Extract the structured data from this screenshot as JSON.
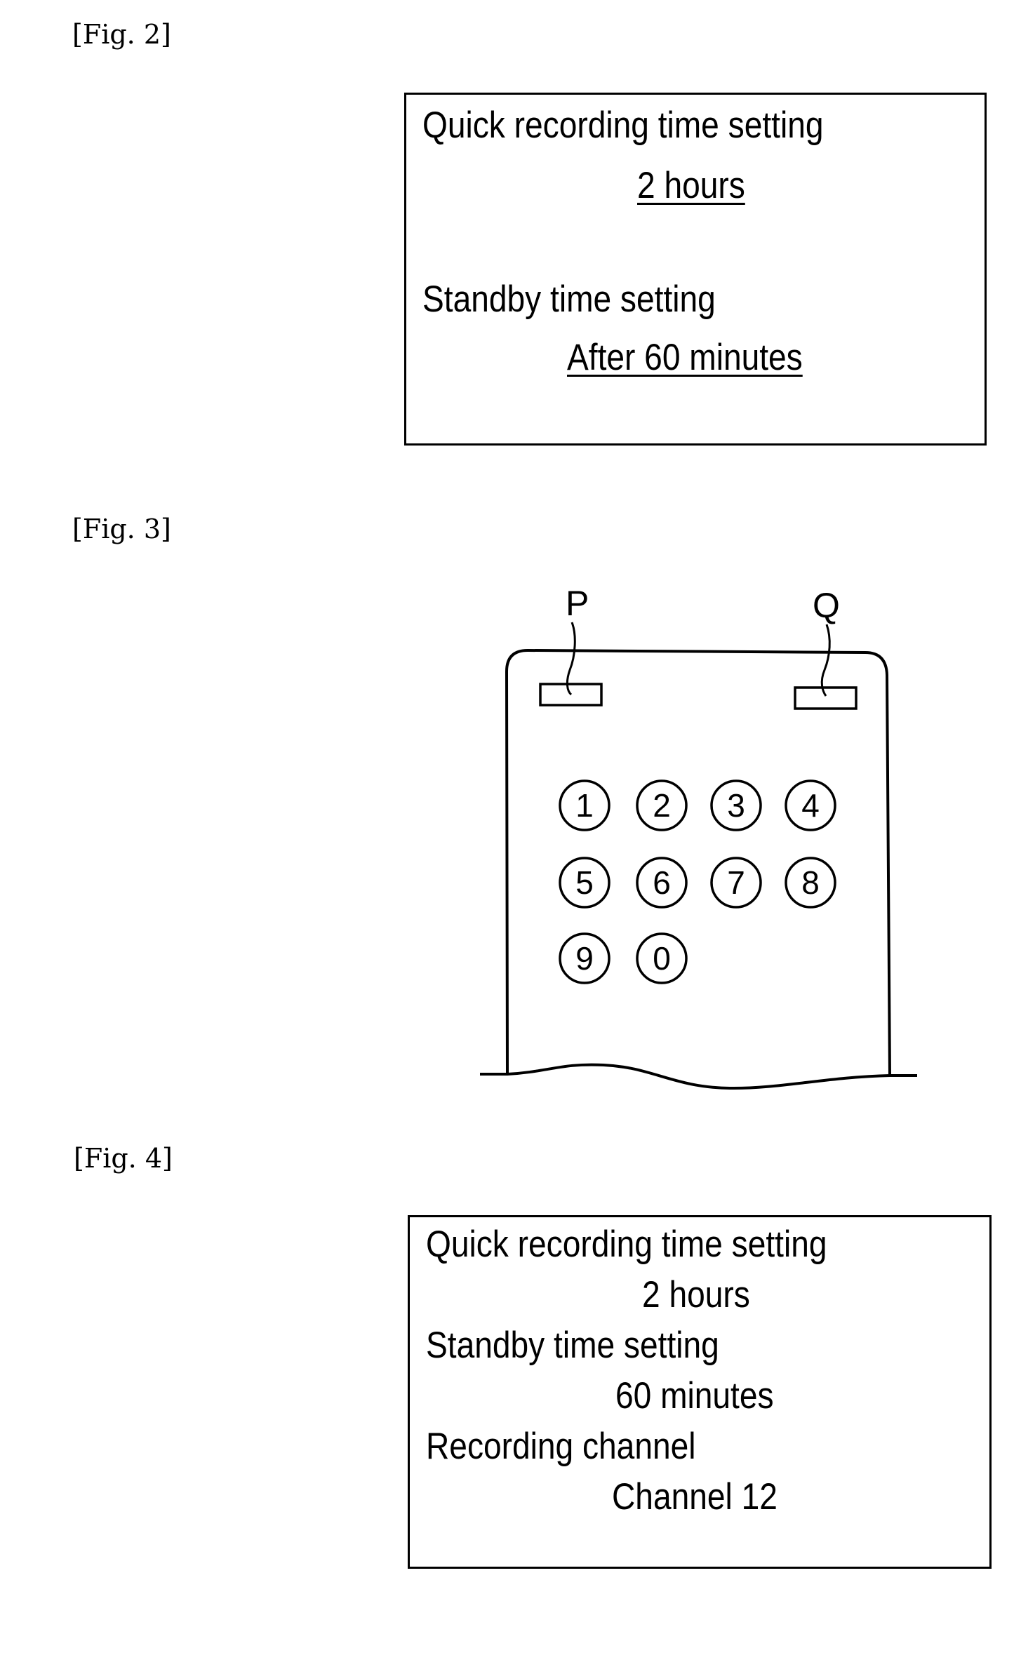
{
  "figures": {
    "fig2": {
      "label": "[Fig. 2]",
      "quick_recording_label": "Quick recording time setting",
      "quick_recording_value": "2 hours",
      "standby_label": "Standby time setting",
      "standby_value": "After 60 minutes"
    },
    "fig3": {
      "label": "[Fig. 3]",
      "callout_p": "P",
      "callout_q": "Q",
      "keys": [
        "1",
        "2",
        "3",
        "4",
        "5",
        "6",
        "7",
        "8",
        "9",
        "0"
      ]
    },
    "fig4": {
      "label": "[Fig. 4]",
      "quick_recording_label": "Quick recording time setting",
      "quick_recording_value": "2 hours",
      "standby_label": "Standby time setting",
      "standby_value": "60 minutes",
      "channel_label": "Recording channel",
      "channel_value": "Channel 12"
    }
  }
}
